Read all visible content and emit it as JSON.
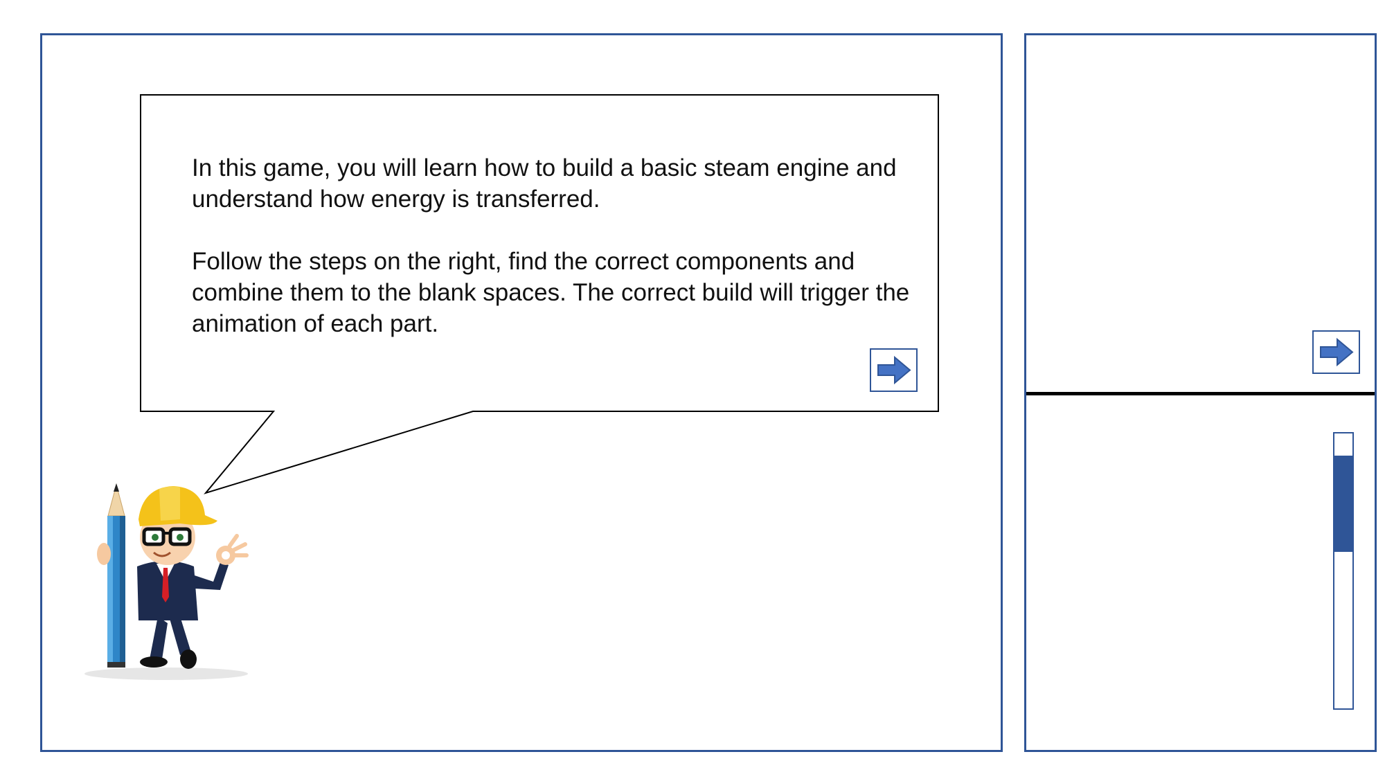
{
  "intro": {
    "paragraph1": "In this game, you will learn how to build a basic steam engine and understand how energy is transferred.",
    "paragraph2": "Follow the steps on the right, find the correct components and combine them to the blank spaces. The correct build will trigger the animation of each part."
  },
  "buttons": {
    "bubble_next_icon": "right-arrow-icon",
    "side_next_icon": "right-arrow-icon"
  },
  "progress": {
    "start_fraction": 0.08,
    "fill_fraction": 0.35
  },
  "colors": {
    "accent": "#2f5597",
    "arrow": "#4472c4",
    "border": "#000000"
  }
}
